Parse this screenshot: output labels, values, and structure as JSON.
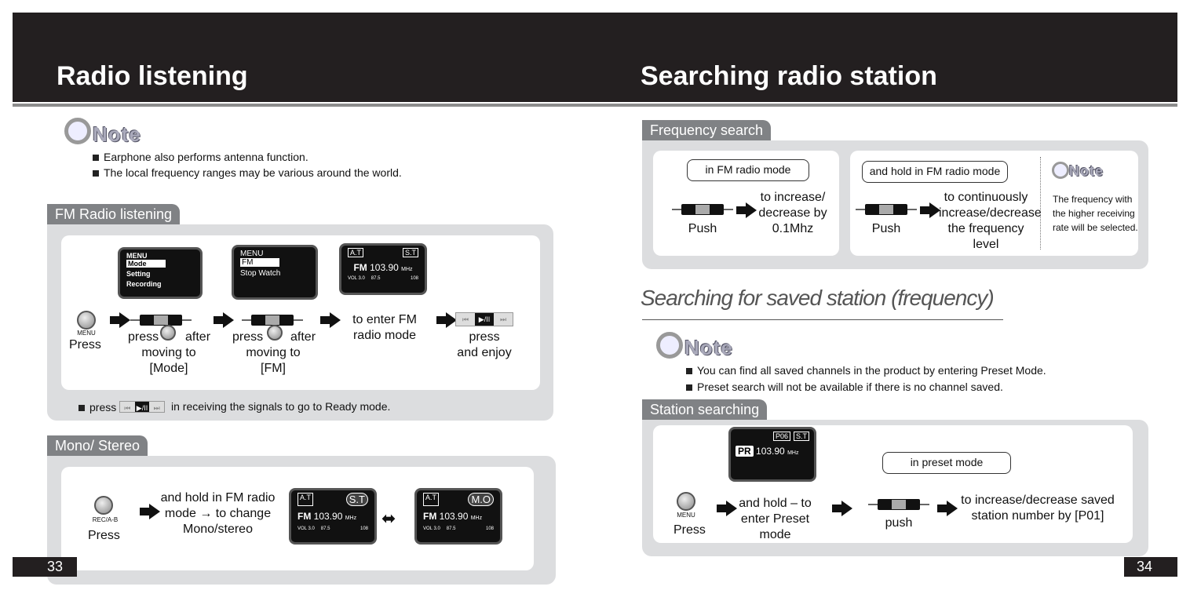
{
  "left": {
    "title": "Radio listening",
    "page_number": "33",
    "note": {
      "logo": "Note",
      "items": [
        "Earphone also performs antenna function.",
        "The local frequency ranges may be various around the world."
      ]
    },
    "fm": {
      "tab": "FM Radio listening",
      "step1": {
        "button": "MENU",
        "label": "Press"
      },
      "step2": {
        "press": "press",
        "after": "after",
        "button": "MENU",
        "text": "moving to [Mode]",
        "screen": {
          "header": "MENU",
          "items": [
            "Mode",
            "Setting",
            "Recording"
          ]
        }
      },
      "step3": {
        "press": "press",
        "after": "after",
        "button": "MENU",
        "text": "moving to [FM]",
        "screen": {
          "header": "MENU",
          "items": [
            "FM",
            "Stop Watch"
          ]
        }
      },
      "step4": {
        "text": "to enter FM radio mode",
        "screen": {
          "at": "A.T",
          "st": "S.T",
          "band": "FM",
          "freq": "103.90",
          "unit": "MHz",
          "vol": "VOL 3.0",
          "min": "87.5",
          "max": "108"
        }
      },
      "step5": {
        "text1": "press",
        "text2": "and enjoy"
      },
      "footer": {
        "pre": "press",
        "post": "in receiving the signals to go to Ready mode."
      }
    },
    "mono": {
      "tab": "Mono/ Stereo",
      "button": "REC/A-B",
      "label": "Press",
      "text": "and hold in FM radio mode → to change Mono/stereo",
      "screen1": {
        "at": "A.T",
        "mode": "S.T",
        "band": "FM",
        "freq": "103.90",
        "unit": "MHz",
        "vol": "VOL 3.0",
        "min": "87.5",
        "max": "108"
      },
      "screen2": {
        "at": "A.T",
        "mode": "M.O",
        "band": "FM",
        "freq": "103.90",
        "unit": "MHz",
        "vol": "VOL 3.0",
        "min": "87.5",
        "max": "108"
      }
    }
  },
  "right": {
    "title": "Searching radio station",
    "page_number": "34",
    "freq": {
      "tab": "Frequency search",
      "box1": {
        "bubble": "in FM radio mode",
        "label": "Push",
        "text": "to increase/ decrease by 0.1Mhz"
      },
      "box2": {
        "bubble": "and hold in FM radio mode",
        "label": "Push",
        "text": "to continuously increase/decrease the frequency level"
      },
      "note": {
        "logo": "Note",
        "text": "The frequency with the higher receiving rate will be selected."
      }
    },
    "saved": {
      "heading": "Searching for saved station (frequency)",
      "note": {
        "logo": "Note",
        "items": [
          "You can find all saved channels in the product by entering Preset Mode.",
          "Preset search will not be available if there is no channel saved."
        ]
      }
    },
    "station": {
      "tab": "Station searching",
      "button": "MENU",
      "label": "Press",
      "step2": "and hold – to enter Preset mode",
      "screen": {
        "pr": "PR",
        "preset": "P06",
        "st": "S.T",
        "freq": "103.90",
        "unit": "MHz"
      },
      "bubble": "in preset mode",
      "push": "push",
      "result": "to increase/decrease saved station number by [P01]"
    }
  }
}
